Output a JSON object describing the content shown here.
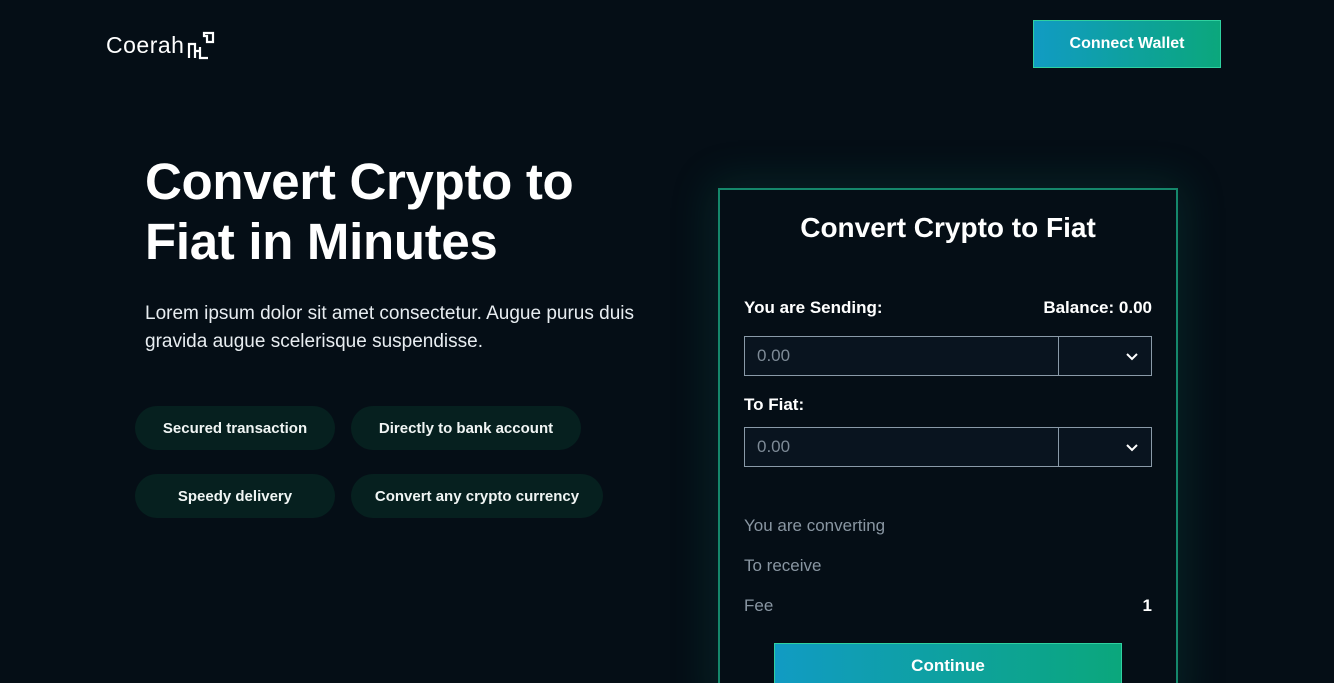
{
  "header": {
    "logo_text": "Coerah",
    "logo_icon": "coerah-mark-icon",
    "connect_wallet_label": "Connect Wallet"
  },
  "hero": {
    "title": "Convert Crypto to Fiat in Minutes",
    "subtitle": "Lorem ipsum dolor sit amet consectetur. Augue purus duis gravida augue scelerisque suspendisse.",
    "features": [
      "Secured transaction",
      "Directly to bank account",
      "Speedy delivery",
      "Convert any crypto currency"
    ]
  },
  "converter": {
    "title": "Convert Crypto to Fiat",
    "sending_label": "You are Sending:",
    "balance_label": "Balance: 0.00",
    "sending_placeholder": "0.00",
    "fiat_label": "To Fiat:",
    "fiat_placeholder": "0.00",
    "dropdown_icon": "chevron-down-icon",
    "converting_label": "You are converting",
    "receive_label": "To receive",
    "fee_label": "Fee",
    "fee_value": "1",
    "continue_label": "Continue"
  },
  "colors": {
    "background": "#050e16",
    "accent_start": "#119bc3",
    "accent_end": "#0ba77c",
    "card_border": "#15876b",
    "pill_background": "#06201f"
  }
}
